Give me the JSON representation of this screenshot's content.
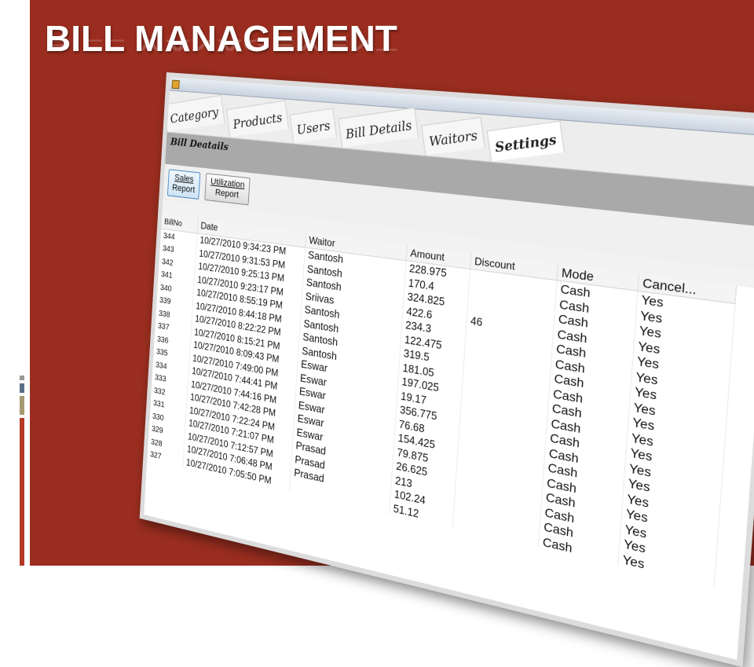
{
  "slide": {
    "title": "BILL MANAGEMENT",
    "colors": {
      "background": "#9a2d1f",
      "title": "#ffffff"
    }
  },
  "app": {
    "tabs": [
      "Category",
      "Products",
      "Users",
      "Bill Details",
      "Waitors",
      "Settings"
    ],
    "active_tab": "Settings",
    "section_title": "Bill Deatails",
    "buttons": {
      "sales_line1": "Sales",
      "sales_line2": "Report",
      "util_line1": "Utilization",
      "util_line2": "Report"
    },
    "columns": [
      "BillNo",
      "Date",
      "Waitor",
      "Amount",
      "Discount",
      "Mode",
      "Cancel..."
    ],
    "rows": [
      [
        "344",
        "10/27/2010 9:34:23 PM"
      ],
      [
        "343",
        "10/27/2010 9:31:53 PM"
      ],
      [
        "342",
        "10/27/2010 9:25:13 PM"
      ],
      [
        "341",
        "10/27/2010 9:23:17 PM"
      ],
      [
        "340",
        "10/27/2010 8:55:19 PM"
      ],
      [
        "339",
        "10/27/2010 8:44:18 PM"
      ],
      [
        "338",
        "10/27/2010 8:22:22 PM"
      ],
      [
        "337",
        "10/27/2010 8:15:21 PM"
      ],
      [
        "336",
        "10/27/2010 8:09:43 PM"
      ],
      [
        "335",
        "10/27/2010 7:49:00 PM"
      ],
      [
        "334",
        "10/27/2010 7:44:41 PM"
      ],
      [
        "333",
        "10/27/2010 7:44:16 PM"
      ],
      [
        "332",
        "10/27/2010 7:42:28 PM"
      ],
      [
        "331",
        "10/27/2010 7:22:24 PM"
      ],
      [
        "330",
        "10/27/2010 7:21:07 PM"
      ],
      [
        "329",
        "10/27/2010 7:12:57 PM"
      ],
      [
        "328",
        "10/27/2010 7:06:48 PM"
      ],
      [
        "327",
        "10/27/2010 7:05:50 PM"
      ]
    ],
    "waitors": [
      "Santosh",
      "Santosh",
      "Santosh",
      "Sriivas",
      "Santosh",
      "Santosh",
      "Santosh",
      "Santosh",
      "Eswar",
      "Eswar",
      "Eswar",
      "Eswar",
      "Eswar",
      "Eswar",
      "Prasad",
      "Prasad",
      "Prasad"
    ],
    "amounts": [
      "228.975",
      "170.4",
      "324.825",
      "422.6",
      "234.3",
      "122.475",
      "319.5",
      "181.05",
      "197.025",
      "19.17",
      "356.775",
      "76.68",
      "154.425",
      "79.875",
      "26.625",
      "213",
      "102.24",
      "51.12"
    ],
    "discounts": [
      "",
      "",
      "",
      "46"
    ],
    "modes": [
      "Cash",
      "Cash",
      "Cash",
      "Cash",
      "Cash",
      "Cash",
      "Cash",
      "Cash",
      "Cash",
      "Cash",
      "Cash",
      "Cash",
      "Cash",
      "Cash",
      "Cash",
      "Cash",
      "Cash",
      "Cash"
    ],
    "cancels": [
      "Yes",
      "Yes",
      "Yes",
      "Yes",
      "Yes",
      "Yes",
      "Yes",
      "Yes",
      "Yes",
      "Yes",
      "Yes",
      "Yes",
      "Yes",
      "Yes",
      "Yes",
      "Yes",
      "Yes",
      "Yes"
    ]
  }
}
